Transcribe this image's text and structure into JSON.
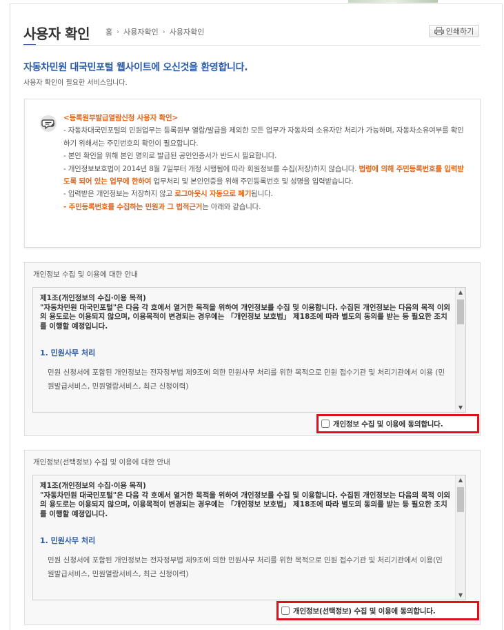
{
  "header": {
    "title": "사용자 확인",
    "breadcrumb": [
      "홈",
      "사용자확인",
      "사용자확인"
    ],
    "print_label": "인쇄하기"
  },
  "welcome": {
    "title": "자동차민원 대국민포털 웹사이트에 오신것을 환영합니다.",
    "subtitle": "사용자 확인이 필요한 서비스입니다."
  },
  "notice": {
    "title": "<등록원부발급열람신청 사용자 확인>",
    "line1": "- 자동차대국민포털의 민원업무는 등록원부 열람/발급을 제외한 모든 업무가 자동차의 소유자만 처리가 가능하며, 자동차소유여부를 확인하기 위해서는 주민번호의 확인이 필요합니다.",
    "line2": "- 본인 확인을 위해 본인 명의로 발급된 공인인증서가 반드시 필요합니다.",
    "line3_a": "- 개인정보보호법이 2014년 8월 7일부터 개정 시행됨에 따라 회원정보를 수집(저장)하지 않습니다. ",
    "line3_b": "법령에 의해 주민등록번호를 입력받도록 되어 있는 업무에 한하여",
    "line3_c": " 업무처리 및 본인인증을 위해 주민등록번호 및 성명을 입력받습니다.",
    "line4_a": "- 입력받은 개인정보는 저장하지 않고 ",
    "line4_b": "로그아웃시 자동으로 폐기",
    "line4_c": "됩니다.",
    "line5_a": "- 주민등록번호를 수집하는 민원과 그 법적근거",
    "line5_b": "는 아래와 같습니다."
  },
  "sections": [
    {
      "title": "개인정보 수집 및 이용에 대한 안내",
      "article_title": "제1조(개인정보의 수집·이용 목적)",
      "article_body": "\"자동차민원 대국민포털\"은 다음 각 호에서 열거한 목적을 위하여 개인정보를 수집 및 이용합니다. 수집된 개인정보는 다음의 목적 이외의 용도로는 이용되지 않으며, 이용목적이 변경되는 경우에는 「개인정보 보호법」 제18조에 따라 별도의 동의를 받는 등 필요한 조치를 이행할 예정입니다.",
      "subheading": "1. 민원사무 처리",
      "paragraph": "민원 신청서에 포함된 개인정보는 전자정부법 제9조에 의한 민원사무 처리를 위한 목적으로 민원 접수기관 및 처리기관에서 이용 (민원발급서비스, 민원열람서비스, 최근 신청이력)",
      "agree_label": "개인정보 수집 및 이용에 동의합니다."
    },
    {
      "title": "개인정보(선택정보) 수집 및 이용에 대한 안내",
      "article_title": "제1조(개인정보의 수집·이용 목적)",
      "article_body": "\"자동차민원 대국민포털\"은 다음 각 호에서 열거한 목적을 위하여 개인정보를 수집 및 이용합니다. 수집된 개인정보는 다음의 목적 이외의 용도로는 이용되지 않으며, 이용목적이 변경되는 경우에는 「개인정보 보호법」 제18조에 따라 별도의 동의를 받는 등 필요한 조치를 이행할 예정입니다.",
      "subheading": "1. 민원사무 처리",
      "paragraph": "민원 신청서에 포함된 개인정보는 전자정부법 제9조에 의한 민원사무 처리를 위한 목적으로 민원 접수기관 및 처리기관에서 이용(민원발급서비스, 민원열람서비스, 최근 신청이력)",
      "agree_label": "개인정보(선택정보) 수집 및 이용에 동의합니다."
    }
  ],
  "colors": {
    "accent": "#2a5aa6",
    "highlight": "#e0641b",
    "agree_border": "#e30e1b"
  }
}
